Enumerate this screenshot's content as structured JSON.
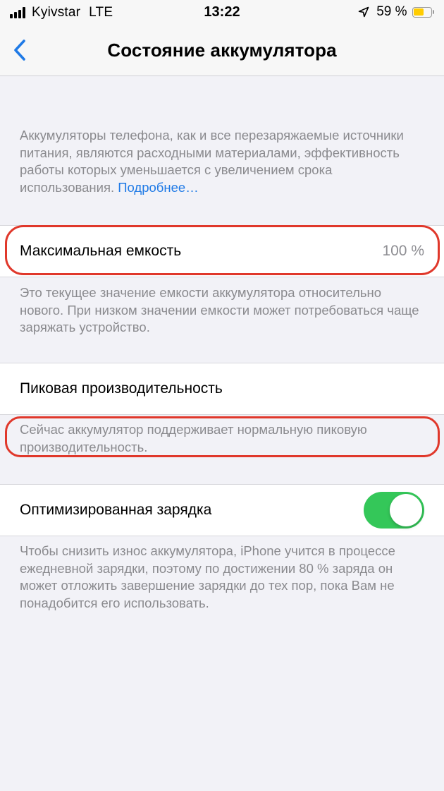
{
  "status_bar": {
    "carrier": "Kyivstar",
    "network": "LTE",
    "time": "13:22",
    "battery_percent": "59 %",
    "battery_level": 0.59,
    "battery_color": "#ffcc00",
    "icons": [
      "signal-bars-icon",
      "location-arrow-icon",
      "battery-icon"
    ]
  },
  "nav": {
    "back_icon": "chevron-left-icon",
    "title": "Состояние аккумулятора"
  },
  "intro": {
    "text": "Аккумуляторы телефона, как и все перезаряжаемые источники питания, являются расходными материалами, эффективность работы которых уменьшается с увеличением срока использования.",
    "link": "Подробнее…"
  },
  "max_capacity": {
    "label": "Максимальная емкость",
    "value": "100 %",
    "footer": "Это текущее значение емкости аккумулятора относительно нового. При низком значении емкости может потребоваться чаще заряжать устройство."
  },
  "peak_performance": {
    "label": "Пиковая производительность",
    "footer": "Сейчас аккумулятор поддерживает нормальную пиковую производительность."
  },
  "optimized_charging": {
    "label": "Оптимизированная зарядка",
    "enabled": true,
    "toggle_color": "#34c759",
    "footer": "Чтобы снизить износ аккумулятора, iPhone учится в процессе ежедневной зарядки, поэтому по достижении 80 % заряда он может отложить завершение зарядки до тех пор, пока Вам не понадобится его использовать."
  },
  "accent_color": "#1f7ae6",
  "annotation_color": "#e0382b"
}
